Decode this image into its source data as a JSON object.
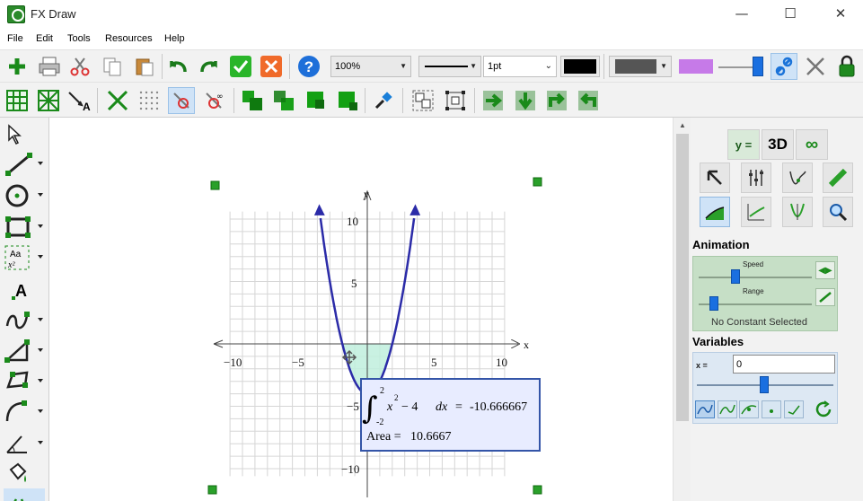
{
  "window": {
    "title": "FX Draw",
    "minimize_glyph": "—",
    "maximize_glyph": "☐",
    "close_glyph": "✕"
  },
  "menu": [
    "File",
    "Edit",
    "Tools",
    "Resources",
    "Help"
  ],
  "toolbar": {
    "zoom": "100%",
    "line_width": "1pt",
    "colors": {
      "stroke": "#000000",
      "fill_dark": "#555555",
      "fill_accent": "#c67ae8"
    },
    "icons": [
      "add-icon",
      "print-icon",
      "cut-icon",
      "copy-icon",
      "paste-icon",
      "undo-icon",
      "redo-icon",
      "accept-icon",
      "reject-icon",
      "help-icon",
      "link-icon",
      "unlink-icon",
      "lock-icon"
    ]
  },
  "graph": {
    "x_axis_label": "x",
    "y_axis_label": "y",
    "x_ticks": [
      "−10",
      "−5",
      "5",
      "10"
    ],
    "y_ticks": [
      "10",
      "5",
      "−5",
      "−10"
    ],
    "function": "x^2 - 4",
    "integral": {
      "upper": "2",
      "lower": "-2",
      "integrand_base": "x",
      "integrand_exp": "2",
      "integrand_rest": "− 4",
      "dx": "dx",
      "equals": "=",
      "value": "-10.666667",
      "area_label": "Area =",
      "area_value": "10.6667"
    },
    "colors": {
      "curve": "#2b2ba8",
      "shade": "#bfeedd",
      "box_fill": "#e8ecff",
      "box_border": "#3455a8"
    }
  },
  "right_panel": {
    "tabs": [
      "y =",
      "3D",
      "∞"
    ],
    "animation": {
      "title": "Animation",
      "speed_label": "Speed",
      "range_label": "Range",
      "status": "No Constant Selected"
    },
    "variables": {
      "title": "Variables",
      "var_label": "x =",
      "value": "0"
    }
  }
}
